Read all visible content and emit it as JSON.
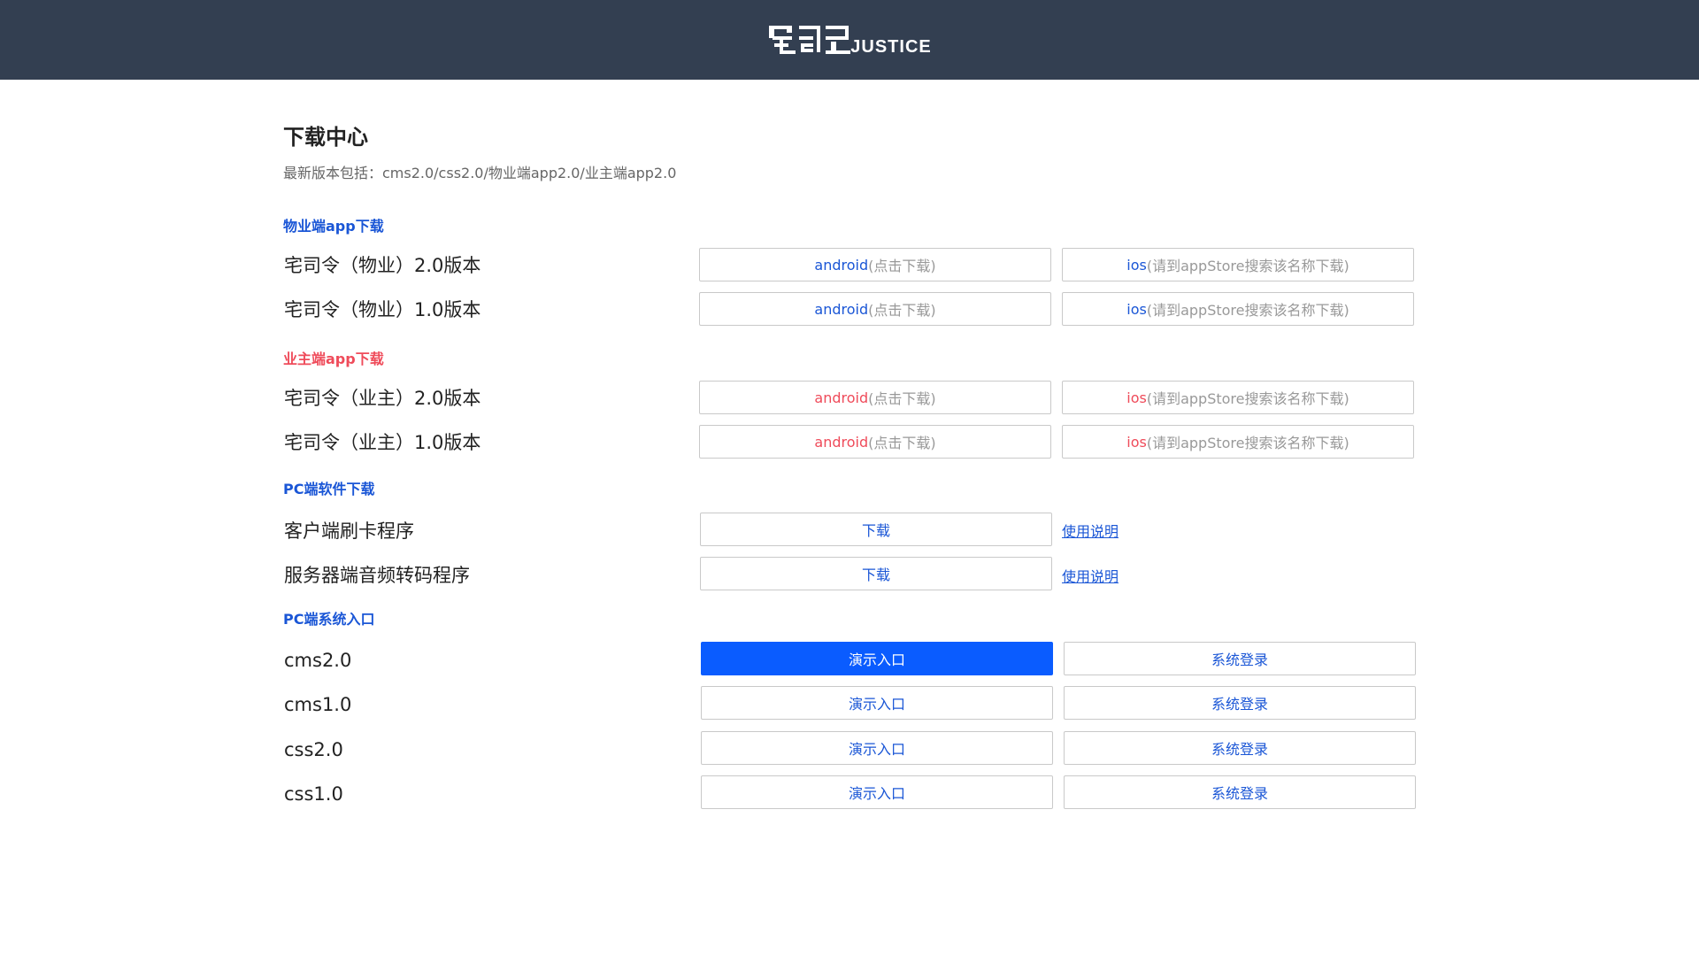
{
  "header": {
    "logo_text": "JUSTICE"
  },
  "page": {
    "title": "下载中心",
    "subtitle": "最新版本包括：cms2.0/css2.0/物业端app2.0/业主端app2.0"
  },
  "colors": {
    "header_bg": "#333f51",
    "accent_blue": "#1a56d6",
    "accent_red": "#ef4b5a",
    "primary_button": "#0a5cff"
  },
  "sections": {
    "property_app": {
      "title": "物业端app下载",
      "rows": [
        {
          "label": "宅司令（物业）2.0版本",
          "android": "android",
          "android_hint": "(点击下载)",
          "ios": "ios",
          "ios_hint": "(请到appStore搜索该名称下载)"
        },
        {
          "label": "宅司令（物业）1.0版本",
          "android": "android",
          "android_hint": "(点击下载)",
          "ios": "ios",
          "ios_hint": "(请到appStore搜索该名称下载)"
        }
      ]
    },
    "owner_app": {
      "title": "业主端app下载",
      "rows": [
        {
          "label": "宅司令（业主）2.0版本",
          "android": "android",
          "android_hint": "(点击下载)",
          "ios": "ios",
          "ios_hint": "(请到appStore搜索该名称下载)"
        },
        {
          "label": "宅司令（业主）1.0版本",
          "android": "android",
          "android_hint": "(点击下载)",
          "ios": "ios",
          "ios_hint": "(请到appStore搜索该名称下载)"
        }
      ]
    },
    "pc_software": {
      "title": "PC端软件下载",
      "rows": [
        {
          "label": "客户端刷卡程序",
          "download": "下载",
          "manual": "使用说明"
        },
        {
          "label": "服务器端音频转码程序",
          "download": "下载",
          "manual": "使用说明"
        }
      ]
    },
    "pc_system": {
      "title": "PC端系统入口",
      "rows": [
        {
          "label": "cms2.0",
          "demo": "演示入口",
          "login": "系统登录"
        },
        {
          "label": "cms1.0",
          "demo": "演示入口",
          "login": "系统登录"
        },
        {
          "label": "css2.0",
          "demo": "演示入口",
          "login": "系统登录"
        },
        {
          "label": "css1.0",
          "demo": "演示入口",
          "login": "系统登录"
        }
      ]
    }
  }
}
